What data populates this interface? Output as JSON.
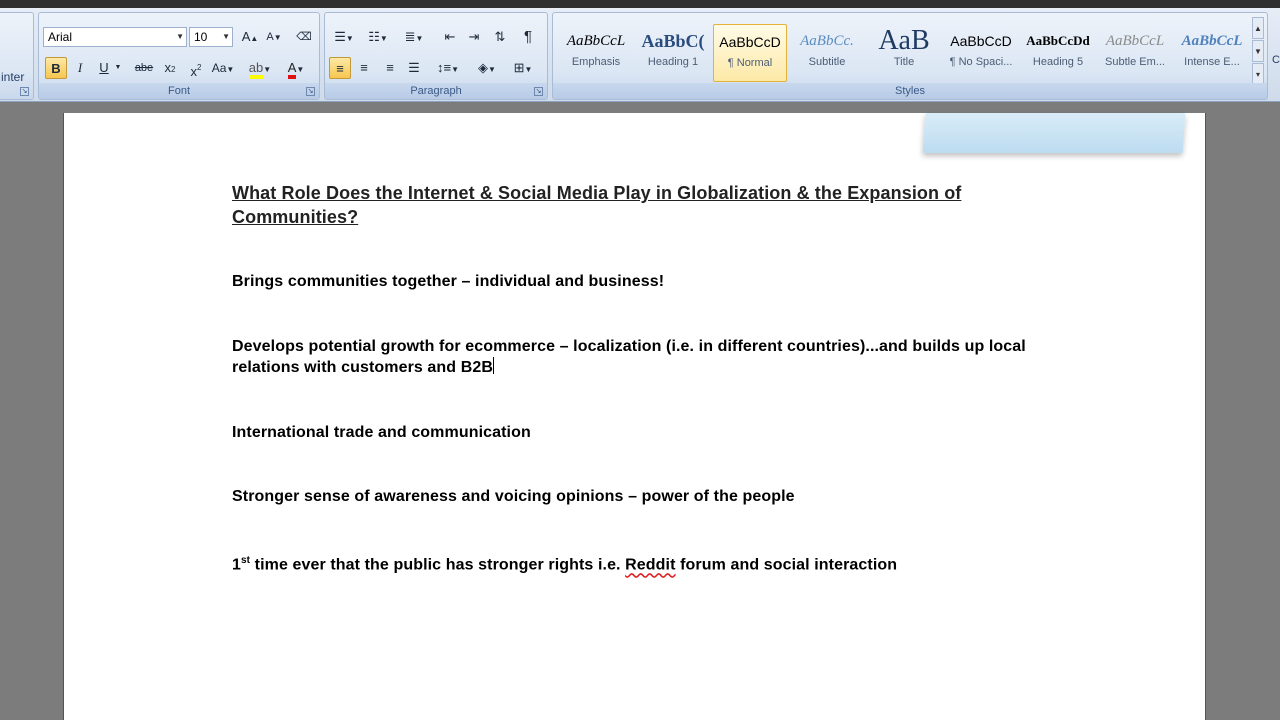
{
  "ribbon": {
    "clipboard_partial_label": "inter",
    "font": {
      "family": "Arial",
      "size": "10",
      "group_label": "Font",
      "buttons": {
        "grow": "A",
        "shrink": "A",
        "bold": "B",
        "italic": "I",
        "underline": "U",
        "strikethrough": "abe",
        "subscript": "x",
        "superscript": "x",
        "change_case": "Aa",
        "font_color": "A"
      }
    },
    "paragraph": {
      "group_label": "Paragraph",
      "pilcrow": "¶"
    },
    "styles": {
      "group_label": "Styles",
      "items": [
        {
          "sample": "AaBbCcL",
          "name": "Emphasis"
        },
        {
          "sample": "AaBbC(",
          "name": "Heading 1"
        },
        {
          "sample": "AaBbCcD",
          "name": "¶ Normal"
        },
        {
          "sample": "AaBbCc.",
          "name": "Subtitle"
        },
        {
          "sample": "AaB",
          "name": "Title"
        },
        {
          "sample": "AaBbCcD",
          "name": "¶ No Spaci..."
        },
        {
          "sample": "AaBbCcDd",
          "name": "Heading 5"
        },
        {
          "sample": "AaBbCcL",
          "name": "Subtle Em..."
        },
        {
          "sample": "AaBbCcL",
          "name": "Intense E..."
        }
      ],
      "edge_letter": "C"
    }
  },
  "document": {
    "title": "What Role Does the Internet & Social Media Play in Globalization & the Expansion of Communities?",
    "p1": "Brings communities  together – individual  and  business!",
    "p2": "Develops  potential  growth for ecommerce  – localization (i.e. in different countries)...and builds up local relations  with customers  and  B2B",
    "p3": "International  trade and  communication",
    "p4": "Stronger  sense  of awareness  and  voicing  opinions  – power of the people",
    "p5_prefix": "1",
    "p5_sup": "st",
    "p5_mid": " time ever  that the public has stronger  rights i.e. ",
    "p5_link": "Reddit",
    "p5_suffix": " forum and  social  interaction"
  }
}
